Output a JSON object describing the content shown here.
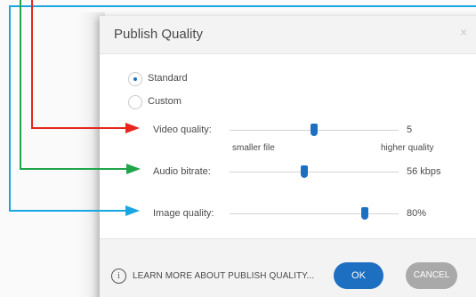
{
  "dialog": {
    "title": "Publish Quality",
    "close_glyph": "×",
    "options": [
      {
        "label": "Standard",
        "selected": true
      },
      {
        "label": "Custom",
        "selected": false
      }
    ],
    "settings": [
      {
        "label": "Video quality:",
        "value": "5",
        "slider_fraction": 0.5,
        "tick_left": "smaller file",
        "tick_right": "higher quality",
        "arrow_color": "#e8261d"
      },
      {
        "label": "Audio bitrate:",
        "value": "56 kbps",
        "slider_fraction": 0.44,
        "arrow_color": "#1fa54a"
      },
      {
        "label": "Image quality:",
        "value": "80%",
        "slider_fraction": 0.8,
        "arrow_color": "#1aa6e0"
      }
    ],
    "footer": {
      "info_icon": "info-icon",
      "learn_more": "LEARN MORE ABOUT PUBLISH QUALITY...",
      "ok": "OK",
      "cancel": "CANCEL"
    }
  },
  "colors": {
    "accent": "#1d6fc2",
    "cancel_bg": "#a9a9a9",
    "header_bg": "#f3f3f3",
    "arrow_red": "#e8261d",
    "arrow_green": "#1fa54a",
    "arrow_blue": "#1aa6e0"
  }
}
